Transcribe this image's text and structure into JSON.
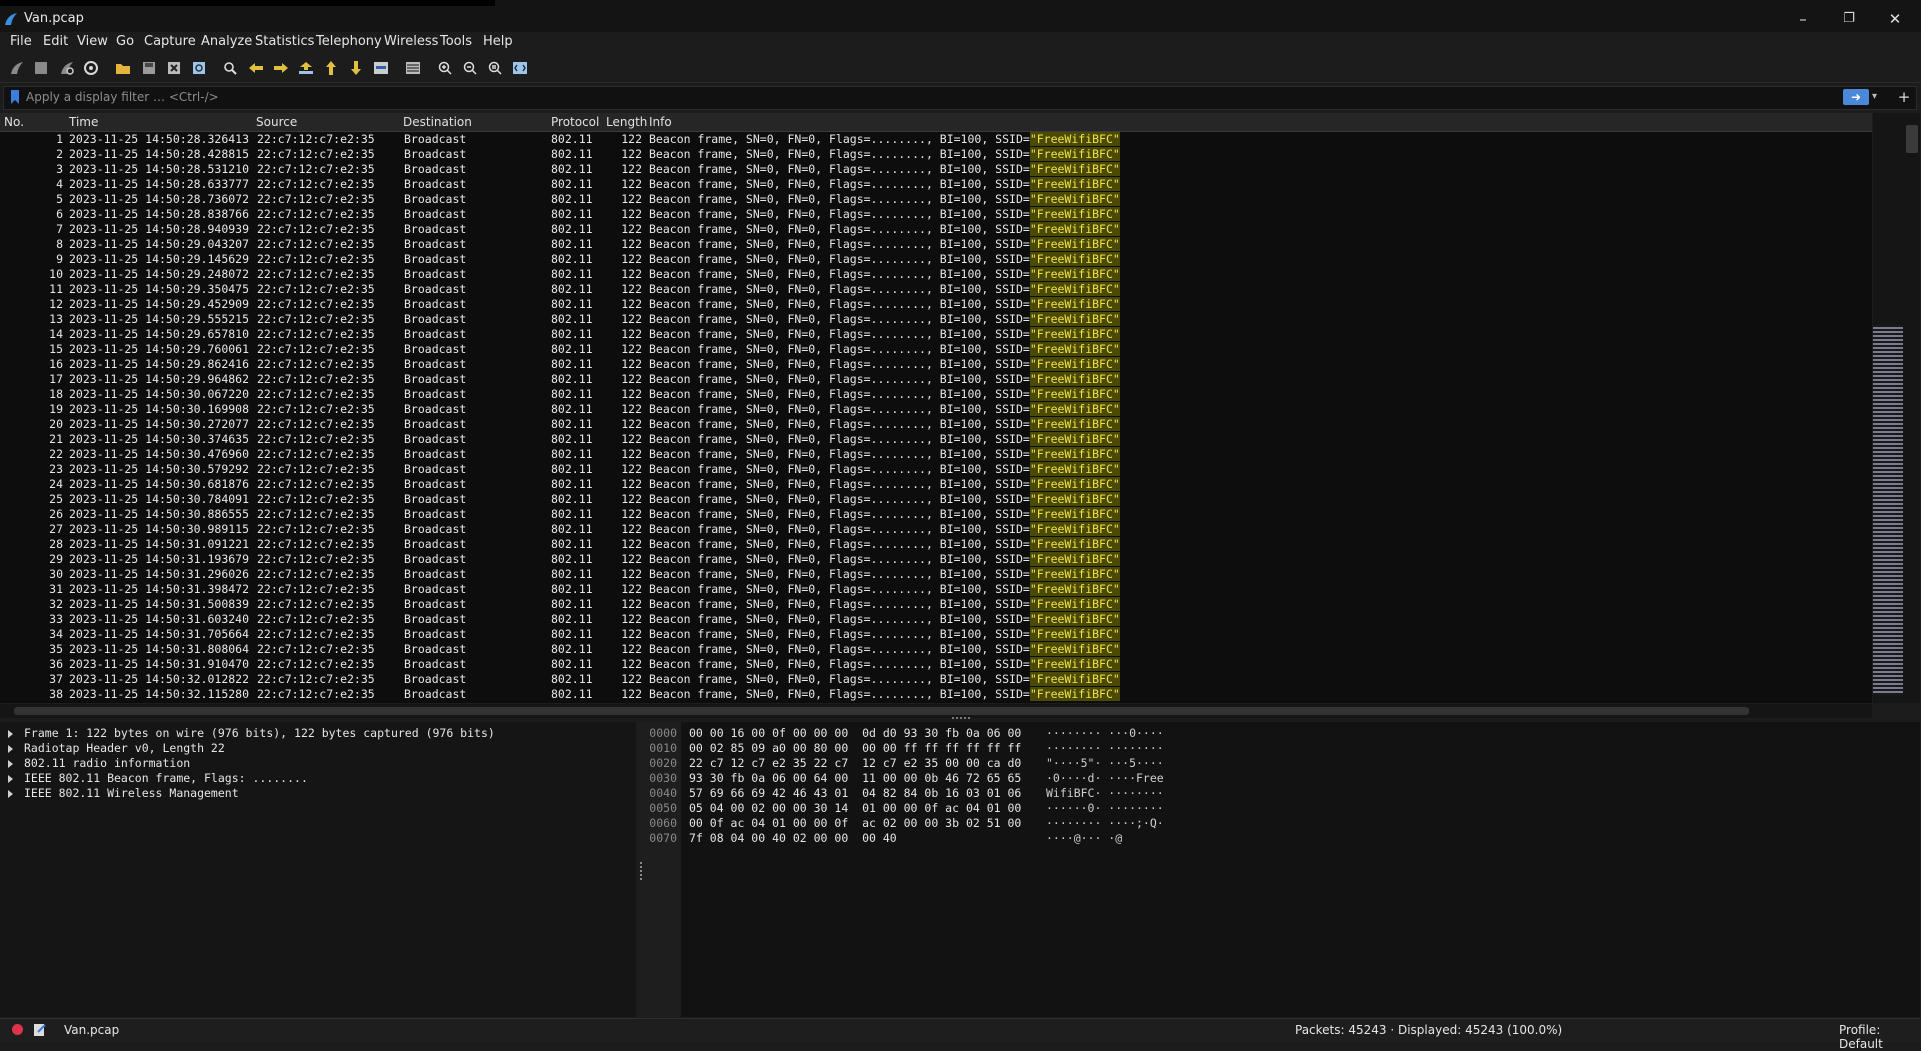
{
  "window": {
    "title": "Van.pcap",
    "minimize": "–",
    "restore": "❐",
    "close": "✕"
  },
  "menu": [
    "File",
    "Edit",
    "View",
    "Go",
    "Capture",
    "Analyze",
    "Statistics",
    "Telephony",
    "Wireless",
    "Tools",
    "Help"
  ],
  "filter": {
    "placeholder": "Apply a display filter … <Ctrl-/>",
    "apply": "➜",
    "dropdown": "▾",
    "add": "+"
  },
  "columns": {
    "no": "No.",
    "time": "Time",
    "source": "Source",
    "destination": "Destination",
    "protocol": "Protocol",
    "length": "Length",
    "info": "Info"
  },
  "packet_defaults": {
    "source": "22:c7:12:c7:e2:35",
    "destination": "Broadcast",
    "protocol": "802.11",
    "length": "122",
    "info": "Beacon frame, SN=0, FN=0, Flags=........, BI=100, SSID=",
    "ssid": "\"FreeWifiBFC\""
  },
  "packets": [
    {
      "no": "1",
      "time": "2023-11-25 14:50:28.326413"
    },
    {
      "no": "2",
      "time": "2023-11-25 14:50:28.428815"
    },
    {
      "no": "3",
      "time": "2023-11-25 14:50:28.531210"
    },
    {
      "no": "4",
      "time": "2023-11-25 14:50:28.633777"
    },
    {
      "no": "5",
      "time": "2023-11-25 14:50:28.736072"
    },
    {
      "no": "6",
      "time": "2023-11-25 14:50:28.838766"
    },
    {
      "no": "7",
      "time": "2023-11-25 14:50:28.940939"
    },
    {
      "no": "8",
      "time": "2023-11-25 14:50:29.043207"
    },
    {
      "no": "9",
      "time": "2023-11-25 14:50:29.145629"
    },
    {
      "no": "10",
      "time": "2023-11-25 14:50:29.248072"
    },
    {
      "no": "11",
      "time": "2023-11-25 14:50:29.350475"
    },
    {
      "no": "12",
      "time": "2023-11-25 14:50:29.452909"
    },
    {
      "no": "13",
      "time": "2023-11-25 14:50:29.555215"
    },
    {
      "no": "14",
      "time": "2023-11-25 14:50:29.657810"
    },
    {
      "no": "15",
      "time": "2023-11-25 14:50:29.760061"
    },
    {
      "no": "16",
      "time": "2023-11-25 14:50:29.862416"
    },
    {
      "no": "17",
      "time": "2023-11-25 14:50:29.964862"
    },
    {
      "no": "18",
      "time": "2023-11-25 14:50:30.067220"
    },
    {
      "no": "19",
      "time": "2023-11-25 14:50:30.169908"
    },
    {
      "no": "20",
      "time": "2023-11-25 14:50:30.272077"
    },
    {
      "no": "21",
      "time": "2023-11-25 14:50:30.374635"
    },
    {
      "no": "22",
      "time": "2023-11-25 14:50:30.476960"
    },
    {
      "no": "23",
      "time": "2023-11-25 14:50:30.579292"
    },
    {
      "no": "24",
      "time": "2023-11-25 14:50:30.681876"
    },
    {
      "no": "25",
      "time": "2023-11-25 14:50:30.784091"
    },
    {
      "no": "26",
      "time": "2023-11-25 14:50:30.886555"
    },
    {
      "no": "27",
      "time": "2023-11-25 14:50:30.989115"
    },
    {
      "no": "28",
      "time": "2023-11-25 14:50:31.091221"
    },
    {
      "no": "29",
      "time": "2023-11-25 14:50:31.193679"
    },
    {
      "no": "30",
      "time": "2023-11-25 14:50:31.296026"
    },
    {
      "no": "31",
      "time": "2023-11-25 14:50:31.398472"
    },
    {
      "no": "32",
      "time": "2023-11-25 14:50:31.500839"
    },
    {
      "no": "33",
      "time": "2023-11-25 14:50:31.603240"
    },
    {
      "no": "34",
      "time": "2023-11-25 14:50:31.705664"
    },
    {
      "no": "35",
      "time": "2023-11-25 14:50:31.808064"
    },
    {
      "no": "36",
      "time": "2023-11-25 14:50:31.910470"
    },
    {
      "no": "37",
      "time": "2023-11-25 14:50:32.012822"
    },
    {
      "no": "38",
      "time": "2023-11-25 14:50:32.115280"
    }
  ],
  "details": [
    "Frame 1: 122 bytes on wire (976 bits), 122 bytes captured (976 bits)",
    "Radiotap Header v0, Length 22",
    "802.11 radio information",
    "IEEE 802.11 Beacon frame, Flags: ........",
    "IEEE 802.11 Wireless Management"
  ],
  "bytes": [
    {
      "offset": "0000",
      "hex": "00 00 16 00 0f 00 00 00  0d d0 93 30 fb 0a 06 00",
      "ascii": "········ ···0····"
    },
    {
      "offset": "0010",
      "hex": "00 02 85 09 a0 00 80 00  00 00 ff ff ff ff ff ff",
      "ascii": "········ ········"
    },
    {
      "offset": "0020",
      "hex": "22 c7 12 c7 e2 35 22 c7  12 c7 e2 35 00 00 ca d0",
      "ascii": "\"····5\"· ···5····"
    },
    {
      "offset": "0030",
      "hex": "93 30 fb 0a 06 00 64 00  11 00 00 0b 46 72 65 65",
      "ascii": "·0····d· ····Free"
    },
    {
      "offset": "0040",
      "hex": "57 69 66 69 42 46 43 01  04 82 84 0b 16 03 01 06",
      "ascii": "WifiBFC· ········"
    },
    {
      "offset": "0050",
      "hex": "05 04 00 02 00 00 30 14  01 00 00 0f ac 04 01 00",
      "ascii": "······0· ········"
    },
    {
      "offset": "0060",
      "hex": "00 0f ac 04 01 00 00 0f  ac 02 00 00 3b 02 51 00",
      "ascii": "········ ····;·Q·"
    },
    {
      "offset": "0070",
      "hex": "7f 08 04 00 40 02 00 00  00 40",
      "ascii": "····@··· ·@"
    }
  ],
  "status": {
    "file": "Van.pcap",
    "packets": "Packets: 45243 · Displayed: 45243 (100.0%)",
    "profile": "Profile: Default"
  },
  "colors": {
    "accent": "#4a88d8",
    "ssid_highlight": "#f2e24a",
    "record": "#e0334a"
  }
}
